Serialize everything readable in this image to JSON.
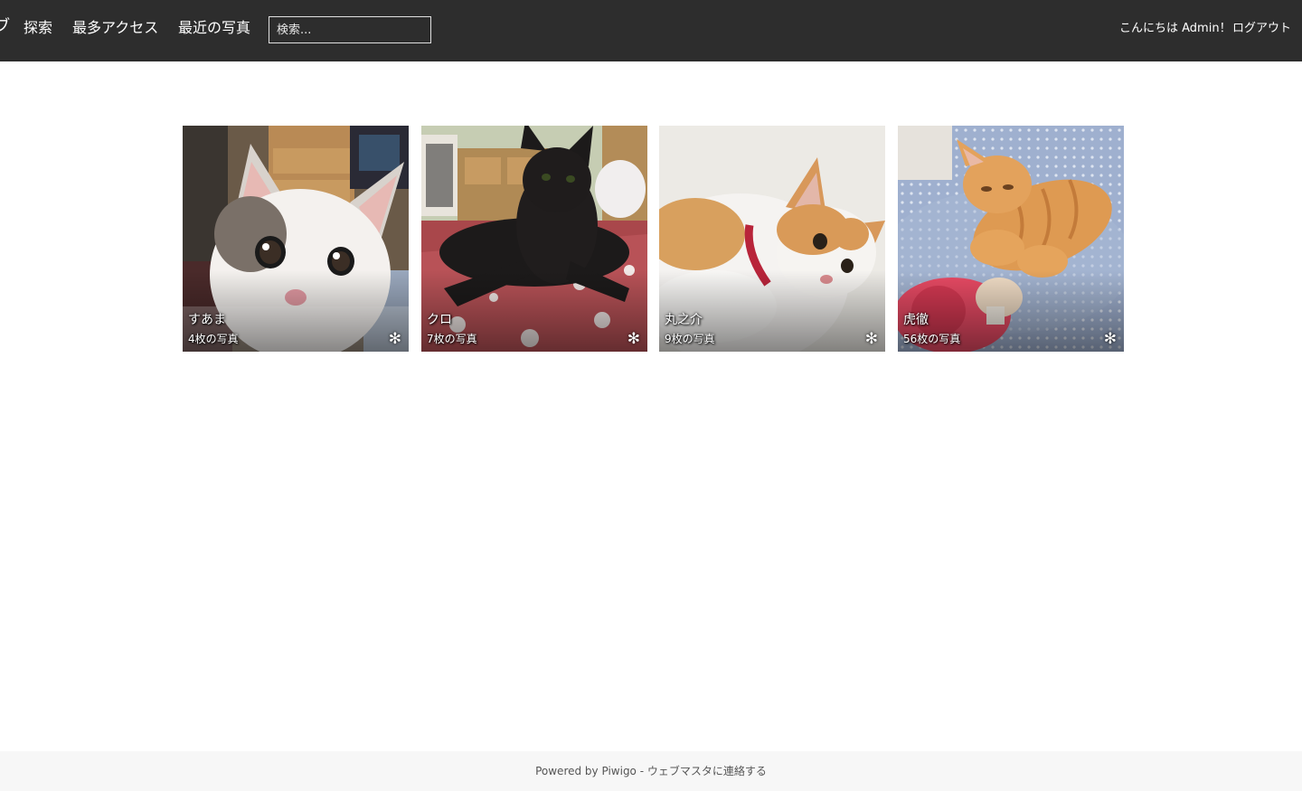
{
  "header": {
    "brand_fragment": "ブ",
    "nav": [
      {
        "label": "探索"
      },
      {
        "label": "最多アクセス"
      },
      {
        "label": "最近の写真"
      }
    ],
    "search": {
      "placeholder": "検索..."
    },
    "greeting": "こんにちは Admin！",
    "logout_label": "ログアウト"
  },
  "albums": [
    {
      "title": "すあま",
      "count": "4枚の写真",
      "badge_icon": "asterisk-icon"
    },
    {
      "title": "クロ",
      "count": "7枚の写真",
      "badge_icon": "asterisk-icon"
    },
    {
      "title": "丸之介",
      "count": "9枚の写真",
      "badge_icon": "asterisk-icon"
    },
    {
      "title": "虎徹",
      "count": "56枚の写真",
      "badge_icon": "asterisk-icon"
    }
  ],
  "footer": {
    "powered_by": "Powered by",
    "piwigo_link": "Piwigo",
    "separator": " - ",
    "contact_link": "ウェブマスタに連絡する"
  },
  "colors": {
    "navbar_bg": "#2d2d2d",
    "nav_text": "#ffffff",
    "footer_bg": "#f7f7f7",
    "footer_text": "#555555"
  }
}
